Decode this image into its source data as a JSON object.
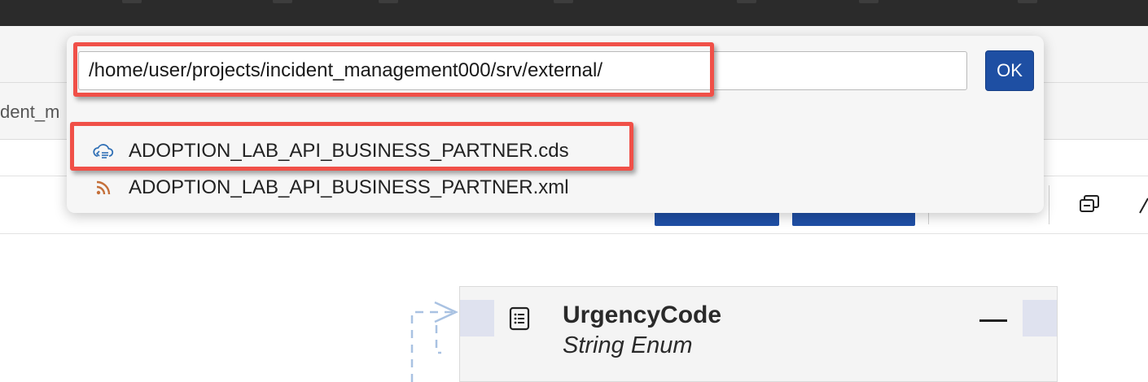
{
  "editor": {
    "partial_tab_label": "dent_m"
  },
  "file_picker": {
    "path_value": "/home/user/projects/incident_management000/srv/external/",
    "ok_label": "OK",
    "files": [
      {
        "name": "ADOPTION_LAB_API_BUSINESS_PARTNER.cds",
        "icon": "cloud-service-icon",
        "color": "#2f6fb5",
        "highlighted": true
      },
      {
        "name": "ADOPTION_LAB_API_BUSINESS_PARTNER.xml",
        "icon": "rss-feed-icon",
        "color": "#c5703a",
        "highlighted": false
      }
    ]
  },
  "diagram": {
    "entity": {
      "title": "UrgencyCode",
      "subtitle": "String Enum",
      "icon": "list-document-icon"
    }
  },
  "annotation": {
    "highlight_color": "#f05048"
  }
}
